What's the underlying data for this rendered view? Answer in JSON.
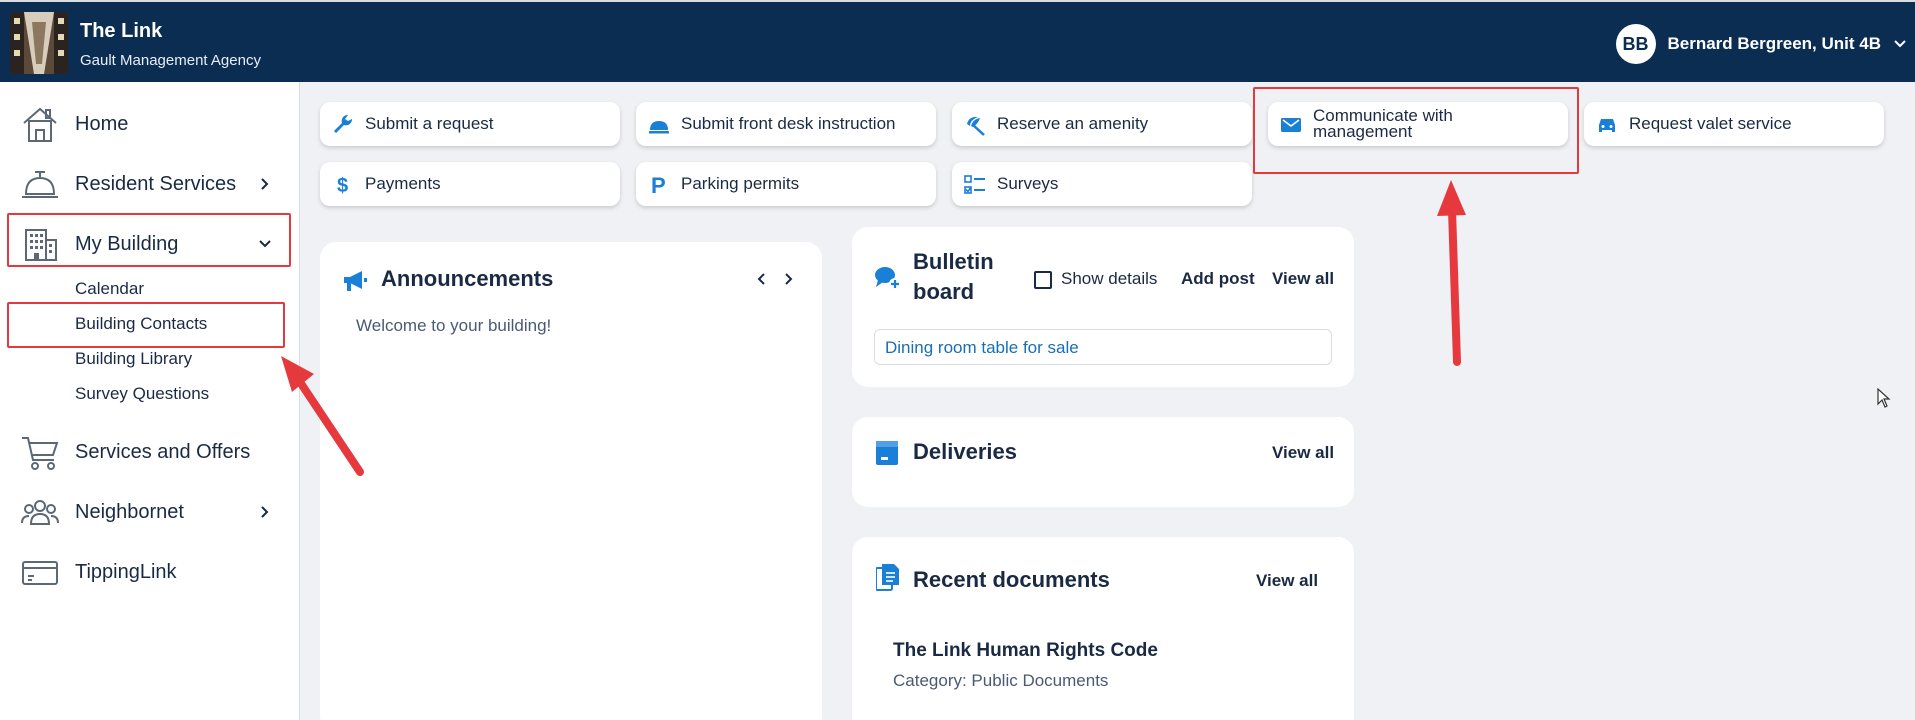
{
  "header": {
    "title": "The Link",
    "subtitle": "Gault Management Agency",
    "user_initials": "BB",
    "user_name": "Bernard Bergreen, Unit 4B"
  },
  "sidebar": {
    "items": [
      {
        "label": "Home",
        "icon": "house-icon"
      },
      {
        "label": "Resident Services",
        "icon": "service-bell-icon"
      },
      {
        "label": "My Building",
        "icon": "building-icon",
        "expanded": true
      },
      {
        "label": "Services and Offers",
        "icon": "shopping-cart-icon"
      },
      {
        "label": "Neighbornet",
        "icon": "people-icon"
      },
      {
        "label": "TippingLink",
        "icon": "card-icon"
      }
    ],
    "my_building_sub": [
      "Calendar",
      "Building Contacts",
      "Building Library",
      "Survey Questions"
    ]
  },
  "quick_actions": {
    "submit_request": "Submit a request",
    "front_desk": "Submit front desk instruction",
    "reserve_amenity": "Reserve an amenity",
    "communicate_1": "Communicate with",
    "communicate_2": "management",
    "valet": "Request valet service",
    "payments": "Payments",
    "parking": "Parking permits",
    "surveys": "Surveys"
  },
  "announcements": {
    "title": "Announcements",
    "message": "Welcome to your building!"
  },
  "bulletin": {
    "title_1": "Bulletin",
    "title_2": "board",
    "show_details": "Show details",
    "add_post": "Add post",
    "view_all": "View all",
    "post": "Dining room table for sale"
  },
  "deliveries": {
    "title": "Deliveries",
    "view_all": "View all"
  },
  "recent_documents": {
    "title": "Recent documents",
    "view_all": "View all",
    "doc_title": "The Link Human Rights Code",
    "doc_category": "Category: Public Documents"
  },
  "colors": {
    "header_bg": "#0b2d52",
    "accent_blue": "#1a7fd6",
    "annotation_red": "#e6393d",
    "page_bg": "#f0f1f4"
  }
}
